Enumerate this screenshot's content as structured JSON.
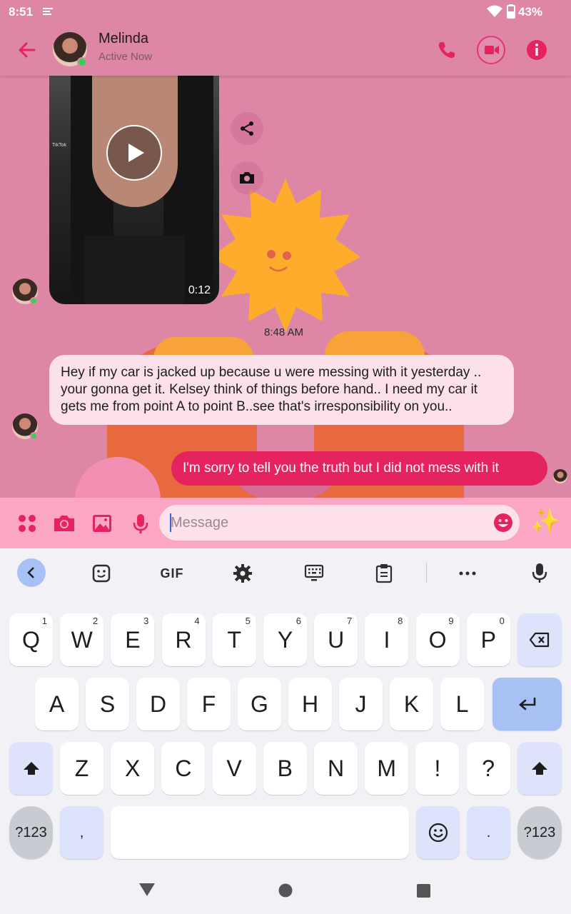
{
  "status_bar": {
    "time": "8:51",
    "battery": "43%"
  },
  "header": {
    "name": "Melinda",
    "status": "Active Now"
  },
  "video_message": {
    "duration": "0:12",
    "watermark": "TikTok"
  },
  "timestamp": "8:48 AM",
  "messages": {
    "incoming": "Hey if my car is jacked up because u were messing with it yesterday .. your gonna get it. Kelsey think of things before hand.. I need my car it gets me from point  A to point B..see that's irresponsibility on you..",
    "outgoing": "I'm sorry to tell you the truth but I did not mess with it"
  },
  "composer": {
    "placeholder": "Message"
  },
  "keyboard": {
    "toolbar": {
      "gif": "GIF"
    },
    "row1": [
      {
        "k": "Q",
        "h": "1"
      },
      {
        "k": "W",
        "h": "2"
      },
      {
        "k": "E",
        "h": "3"
      },
      {
        "k": "R",
        "h": "4"
      },
      {
        "k": "T",
        "h": "5"
      },
      {
        "k": "Y",
        "h": "6"
      },
      {
        "k": "U",
        "h": "7"
      },
      {
        "k": "I",
        "h": "8"
      },
      {
        "k": "O",
        "h": "9"
      },
      {
        "k": "P",
        "h": "0"
      }
    ],
    "row2": [
      "A",
      "S",
      "D",
      "F",
      "G",
      "H",
      "J",
      "K",
      "L"
    ],
    "row3": [
      "Z",
      "X",
      "C",
      "V",
      "B",
      "N",
      "M",
      "!",
      "?"
    ],
    "symbols_label": "?123",
    "comma": ",",
    "period": "."
  },
  "colors": {
    "accent": "#e5245f",
    "background": "#dd86a6",
    "composer": "#fba6c4",
    "incoming_bubble": "#fde1ea"
  }
}
